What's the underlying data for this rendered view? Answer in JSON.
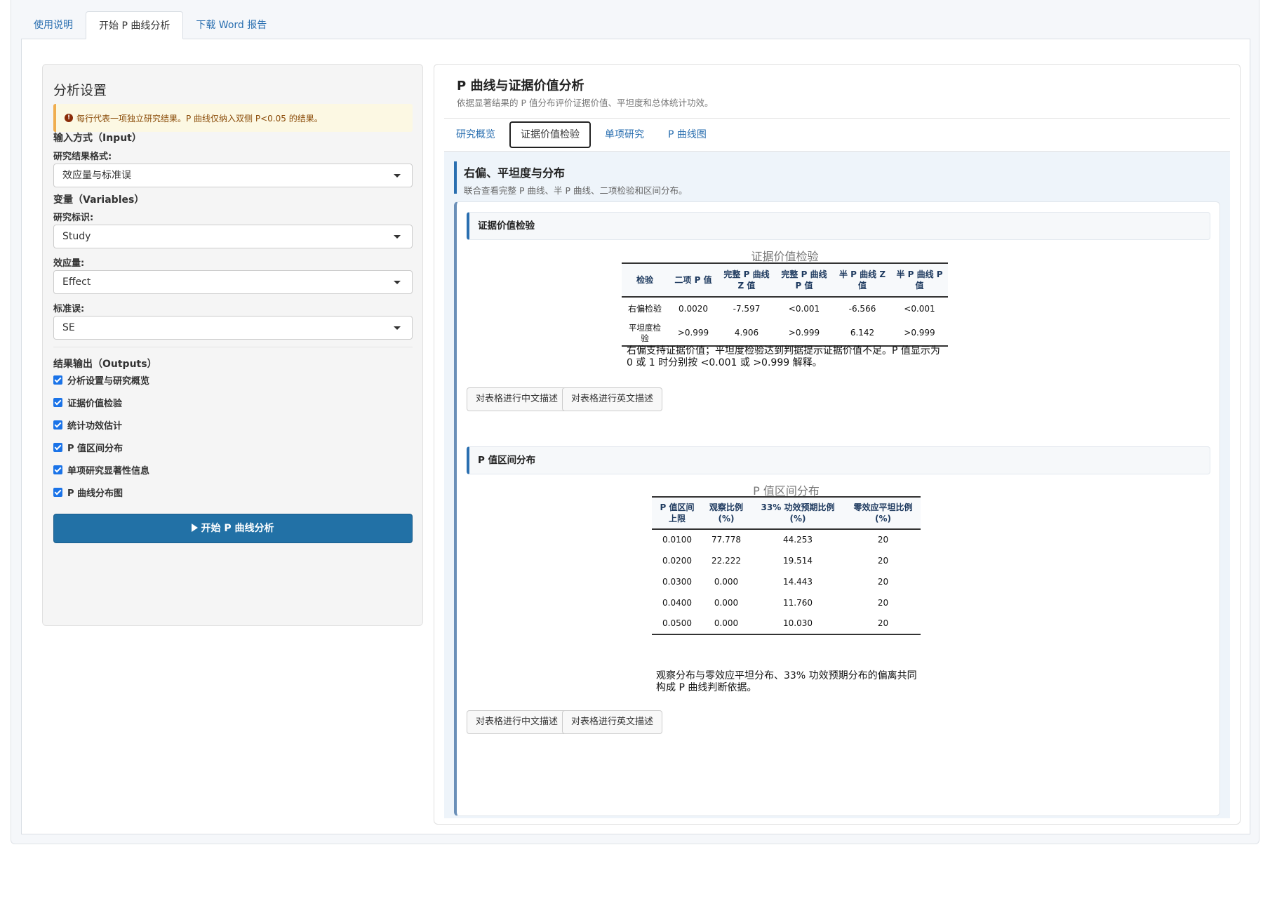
{
  "top_tabs": [
    "使用说明",
    "开始 P 曲线分析",
    "下载 Word 报告"
  ],
  "left": {
    "title": "分析设置",
    "alert": "每行代表一项独立研究结果。P 曲线仅纳入双侧 P<0.05 的结果。",
    "input_section": "输入方式（Input）",
    "format_label": "研究结果格式:",
    "format_value": "效应量与标准误",
    "variables_section": "变量（Variables）",
    "study_label": "研究标识:",
    "study_value": "Study",
    "effect_label": "效应量:",
    "effect_value": "Effect",
    "se_label": "标准误:",
    "se_value": "SE",
    "outputs_section": "结果输出（Outputs）",
    "outputs": [
      "分析设置与研究概览",
      "证据价值检验",
      "统计功效估计",
      "P 值区间分布",
      "单项研究显著性信息",
      "P 曲线分布图"
    ],
    "run_button": "开始 P 曲线分析"
  },
  "right": {
    "title": "P 曲线与证据价值分析",
    "subtitle": "依据显著结果的 P 值分布评价证据价值、平坦度和总体统计功效。",
    "tabs": [
      "研究概览",
      "证据价值检验",
      "单项研究",
      "P 曲线图"
    ],
    "active_tab": 1,
    "section_title": "右偏、平坦度与分布",
    "section_sub": "联合查看完整 P 曲线、半 P 曲线、二项检验和区间分布。",
    "evidence": {
      "heading": "证据价值检验",
      "caption": "证据价值检验",
      "headers": [
        "检验",
        "二项 P 值",
        "完整 P 曲线 Z 值",
        "完整 P 曲线 P 值",
        "半 P 曲线 Z 值",
        "半 P 曲线 P 值"
      ],
      "rows": [
        [
          "右偏检验",
          "0.0020",
          "-7.597",
          "<0.001",
          "-6.566",
          "<0.001"
        ],
        [
          "平坦度检验",
          ">0.999",
          "4.906",
          ">0.999",
          "6.142",
          ">0.999"
        ]
      ],
      "note": "右偏支持证据价值；平坦度检验达到判据提示证据价值不足。P 值显示为 0 或 1 时分别按 <0.001 或 >0.999 解释。"
    },
    "distribution": {
      "heading": "P 值区间分布",
      "caption": "P 值区间分布",
      "headers": [
        "P 值区间上限",
        "观察比例 (%)",
        "33% 功效预期比例 (%)",
        "零效应平坦比例 (%)"
      ],
      "rows": [
        [
          "0.0100",
          "77.778",
          "44.253",
          "20"
        ],
        [
          "0.0200",
          "22.222",
          "19.514",
          "20"
        ],
        [
          "0.0300",
          "0.000",
          "14.443",
          "20"
        ],
        [
          "0.0400",
          "0.000",
          "11.760",
          "20"
        ],
        [
          "0.0500",
          "0.000",
          "10.030",
          "20"
        ]
      ],
      "note": "观察分布与零效应平坦分布、33% 功效预期分布的偏离共同构成 P 曲线判断依据。"
    },
    "desc_cn": "对表格进行中文描述",
    "desc_en": "对表格进行英文描述"
  }
}
